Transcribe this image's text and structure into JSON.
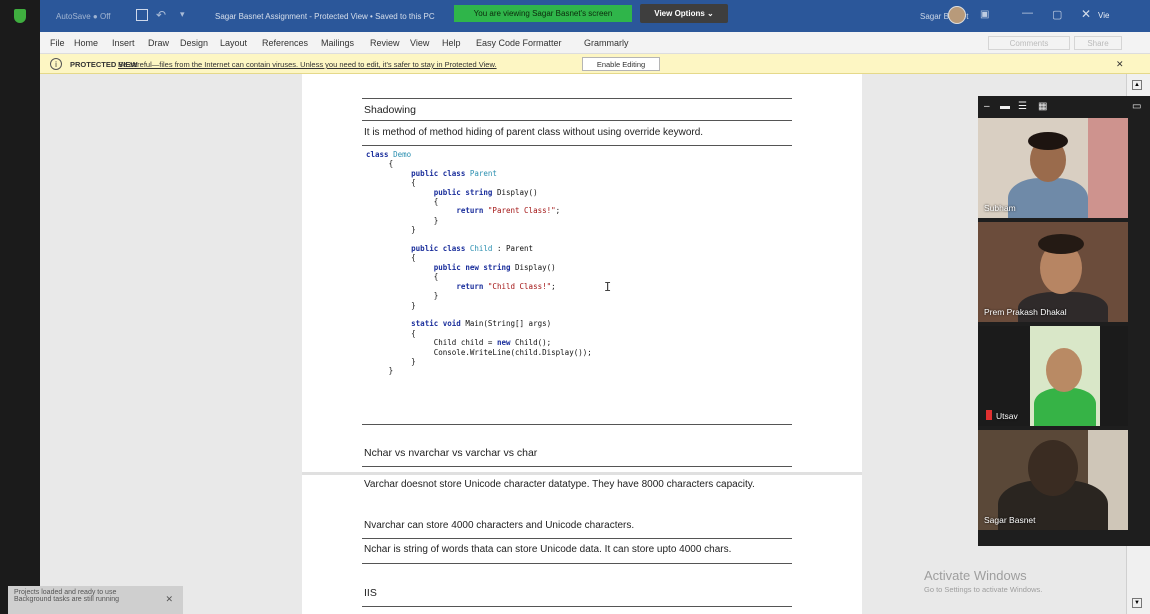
{
  "titlebar": {
    "autosave": "AutoSave ● Off",
    "doc_title": "Sagar Basnet Assignment - Protected View • Saved to this PC",
    "viewing_banner": "You are viewing Sagar Basnet's screen",
    "view_options": "View Options ⌄",
    "user_name": "Sagar Basnet",
    "extra": "Vie"
  },
  "menu": {
    "items": [
      "File",
      "Home",
      "Insert",
      "Draw",
      "Design",
      "Layout",
      "References",
      "Mailings",
      "Review",
      "View",
      "Help",
      "Easy Code Formatter",
      "Grammarly"
    ],
    "comments": "Comments",
    "share": "Share"
  },
  "protected": {
    "label": "PROTECTED VIEW",
    "message": "Be careful—files from the Internet can contain viruses. Unless you need to edit, it's safer to stay in Protected View.",
    "enable_button": "Enable Editing"
  },
  "document": {
    "shadowing_heading": "Shadowing",
    "shadowing_desc": "It is method of method hiding of parent class without using override keyword.",
    "nchar_heading": "Nchar vs nvarchar vs varchar vs char",
    "varchar_text": "Varchar doesnot store Unicode character datatype. They have 8000 characters capacity.",
    "nvarchar_text": "Nvarchar can store 4000 characters and Unicode characters.",
    "nchar_text": "Nchar is string of words thata can store Unicode data. It can store upto 4000 chars.",
    "iis_heading": "IIS"
  },
  "participants": [
    {
      "name": "Subham"
    },
    {
      "name": "Prem Prakash Dhakal"
    },
    {
      "name": "Utsav"
    },
    {
      "name": "Sagar Basnet"
    }
  ],
  "notification": {
    "line1": "Projects loaded and ready to use",
    "line2": "Background tasks are still running"
  },
  "activate": {
    "title": "Activate Windows",
    "subtitle": "Go to Settings to activate Windows."
  }
}
